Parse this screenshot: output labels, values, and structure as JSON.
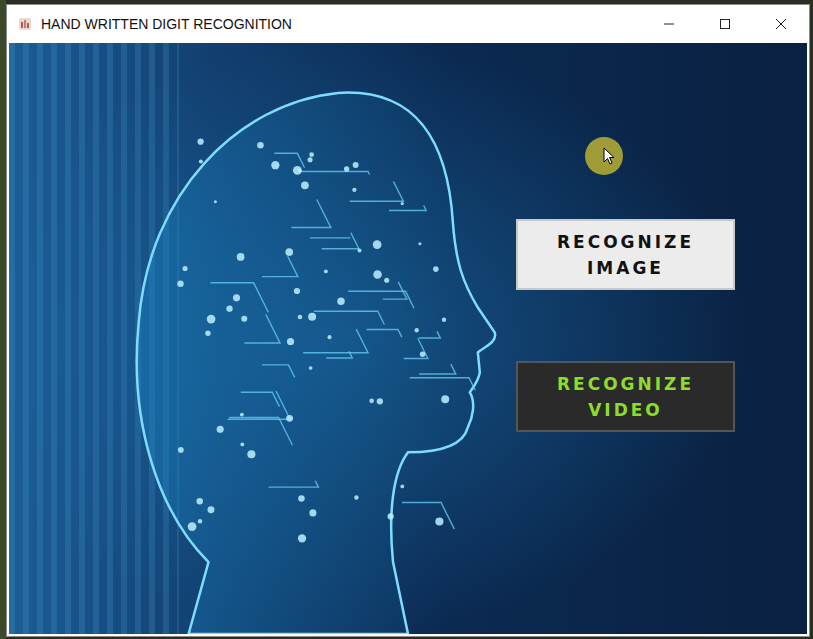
{
  "window": {
    "title": "HAND WRITTEN DIGIT RECOGNITION"
  },
  "buttons": [
    {
      "lines": [
        "RECOGNIZE",
        "IMAGE"
      ],
      "kind": "light"
    },
    {
      "lines": [
        "RECOGNIZE",
        "VIDEO"
      ],
      "kind": "dark"
    }
  ]
}
